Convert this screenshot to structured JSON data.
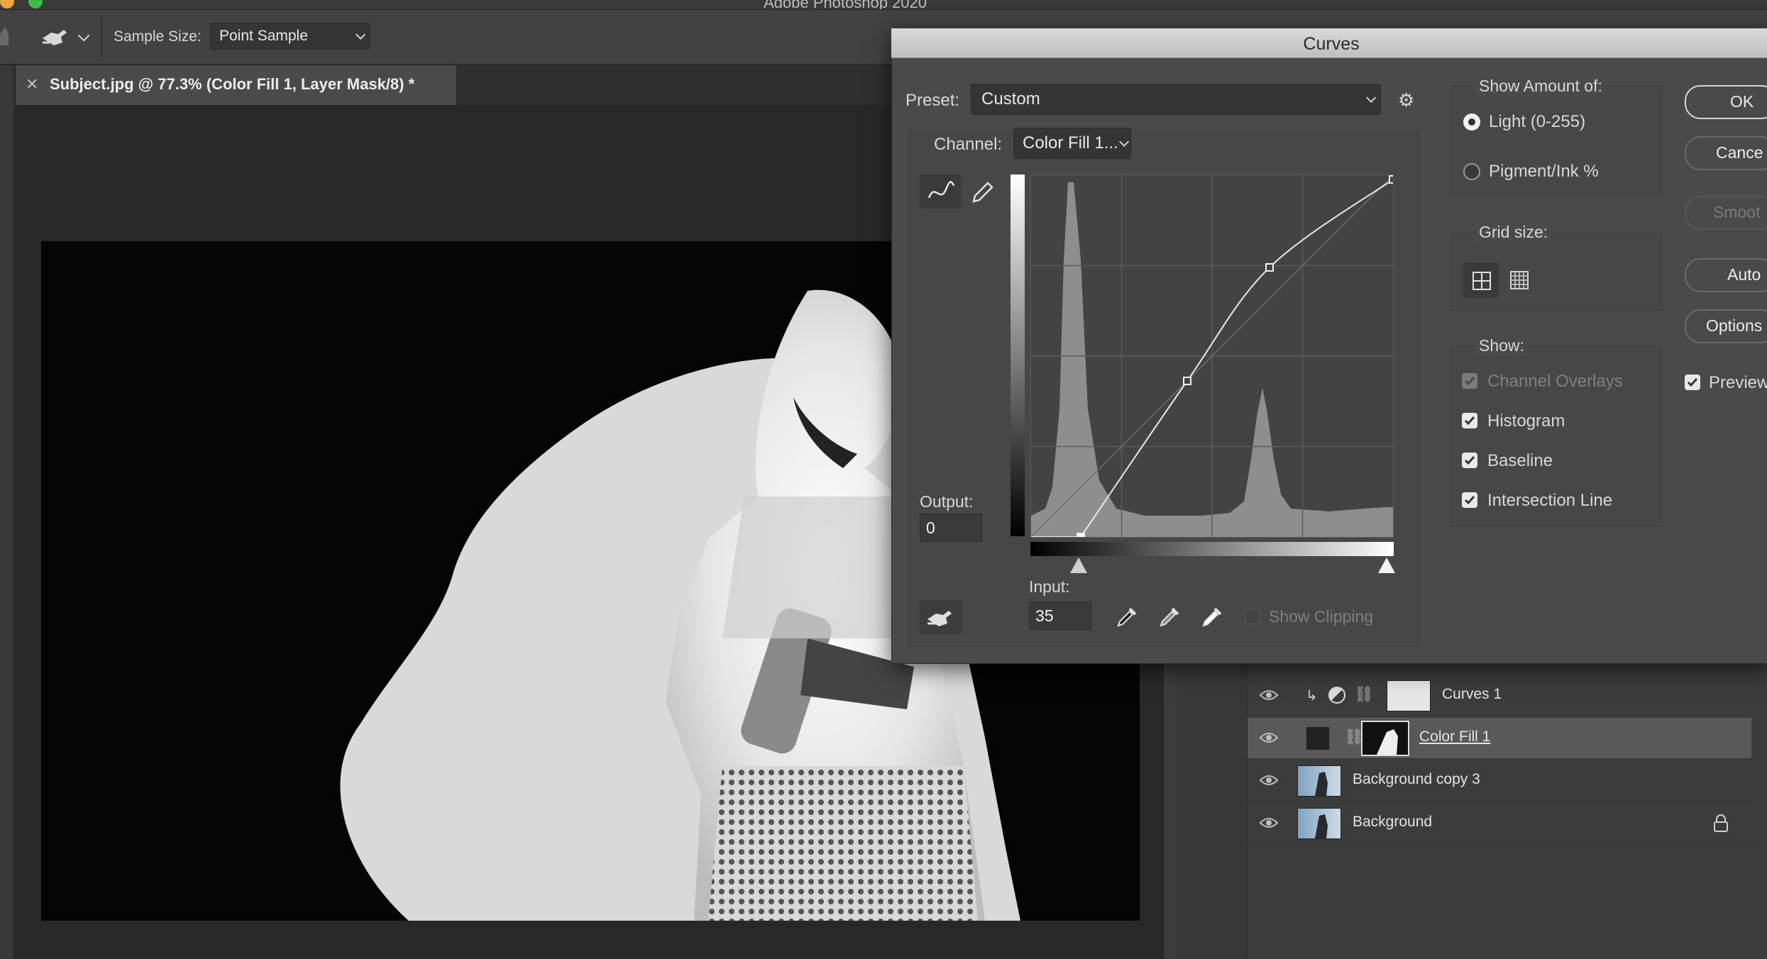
{
  "app": {
    "title": "Adobe Photoshop 2020"
  },
  "options_bar": {
    "sample_size_label": "Sample Size:",
    "sample_size_value": "Point Sample"
  },
  "document": {
    "tab_label": "Subject.jpg @ 77.3% (Color Fill 1, Layer Mask/8) *"
  },
  "layers": [
    {
      "name": "Curves 1",
      "type": "adjustment",
      "clipped": true,
      "selected": false
    },
    {
      "name": "Color Fill 1",
      "type": "fill",
      "selected": true
    },
    {
      "name": "Background copy 3",
      "type": "image",
      "selected": false
    },
    {
      "name": "Background",
      "type": "image",
      "locked": true,
      "selected": false
    }
  ],
  "curves_dialog": {
    "title": "Curves",
    "preset_label": "Preset:",
    "preset_value": "Custom",
    "channel_label": "Channel:",
    "channel_value": "Color Fill 1...",
    "output_label": "Output:",
    "output_value": "0",
    "input_label": "Input:",
    "input_value": "35",
    "show_clipping_label": "Show Clipping",
    "show_clipping_checked": false,
    "show_amount_label": "Show Amount of:",
    "light_label": "Light  (0-255)",
    "light_selected": true,
    "pigment_label": "Pigment/Ink %",
    "pigment_selected": false,
    "grid_size_label": "Grid size:",
    "show_label": "Show:",
    "show_options": [
      {
        "label": "Channel Overlays",
        "checked": true,
        "disabled": true
      },
      {
        "label": "Histogram",
        "checked": true,
        "disabled": false
      },
      {
        "label": "Baseline",
        "checked": true,
        "disabled": false
      },
      {
        "label": "Intersection Line",
        "checked": true,
        "disabled": false
      }
    ],
    "buttons": {
      "ok": "OK",
      "cancel": "Cance",
      "smooth": "Smoot",
      "auto": "Auto",
      "options": "Options"
    },
    "preview_label": "Preview",
    "preview_checked": true,
    "curve_points": [
      {
        "input": 35,
        "output": 0
      },
      {
        "input": 110,
        "output": 110
      },
      {
        "input": 168,
        "output": 190
      },
      {
        "input": 255,
        "output": 252
      }
    ]
  }
}
